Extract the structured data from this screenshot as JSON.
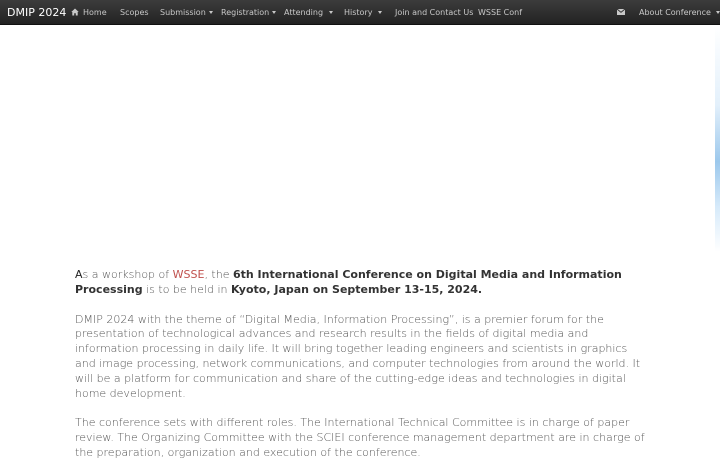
{
  "navbar": {
    "brand": "DMIP 2024",
    "items": {
      "home": "Home",
      "scopes": "Scopes",
      "submission": "Submission",
      "registration": "Registration",
      "attending": "Attending",
      "history": "History",
      "join": "Join and Contact Us",
      "wsse": "WSSE Conf",
      "about": "About Conference"
    },
    "icons": {
      "home": "home-icon",
      "mail": "envelope-icon",
      "caret": "caret-down-icon"
    }
  },
  "intro": {
    "first_letter": "A",
    "text_1": "s a workshop of ",
    "link": "WSSE",
    "text_2": ", the ",
    "bold_1": "6th International Conference on Digital Media and Information Processing",
    "text_3": " is to be held in ",
    "bold_2": "Kyoto, Japan on September 13-15, 2024."
  },
  "paragraphs": {
    "p1": "DMIP 2024 with the theme of “Digital Media, Information Processing”, is a premier forum for the presentation of technological advances and research results in the fields of digital media and information processing in daily life. It will bring together leading engineers and scientists in graphics and image processing, network communications, and computer technologies from around the world. It will be a platform for communication and share of the cutting-edge ideas and technologies in digital home development.",
    "p2": "The conference sets with different roles. The International Technical Committee is in charge of paper review. The Organizing Committee with the SCIEI conference management department are in charge of the preparation, organization and execution of the conference."
  },
  "colors": {
    "navbar_bg": "#2a2a2a",
    "nav_text": "#c8c8c8",
    "link": "#c0504d",
    "body_text": "#333333"
  }
}
